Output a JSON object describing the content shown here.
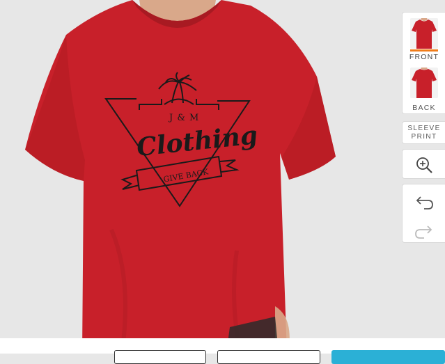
{
  "views": {
    "front_label": "FRONT",
    "back_label": "BACK",
    "active": "front"
  },
  "tools": {
    "sleeve_label_line1": "SLEEVE",
    "sleeve_label_line2": "PRINT",
    "zoom_icon": "zoom-in-icon",
    "undo_icon": "undo-icon",
    "redo_icon": "redo-icon"
  },
  "design": {
    "top_text": "J & M",
    "main_text": "Clothing",
    "banner_text": "GIVE BACK"
  },
  "colors": {
    "shirt": "#c8202a",
    "accent": "#f07d1a",
    "primary_button": "#2bb0d6"
  }
}
